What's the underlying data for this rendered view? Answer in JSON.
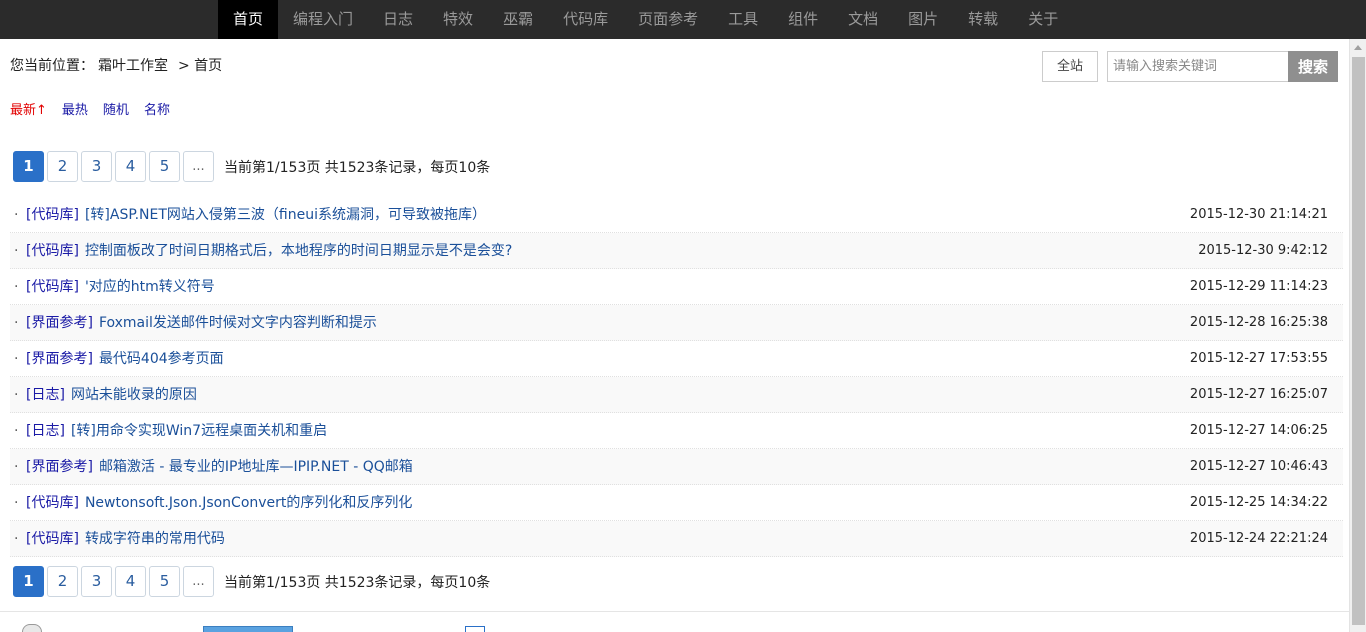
{
  "nav": {
    "items": [
      "首页",
      "编程入门",
      "日志",
      "特效",
      "巫霸",
      "代码库",
      "页面参考",
      "工具",
      "组件",
      "文档",
      "图片",
      "转载",
      "关于"
    ],
    "active_index": 0
  },
  "breadcrumb": {
    "prefix": "您当前位置：",
    "site": "霜叶工作室",
    "current": "> 首页"
  },
  "search": {
    "scope_label": "全站",
    "placeholder": "请输入搜索关键词",
    "button_label": "搜索"
  },
  "sorts": [
    {
      "label": "最新↑",
      "active": true
    },
    {
      "label": "最热",
      "active": false
    },
    {
      "label": "随机",
      "active": false
    },
    {
      "label": "名称",
      "active": false
    }
  ],
  "pager": {
    "pages": [
      "1",
      "2",
      "3",
      "4",
      "5",
      "..."
    ],
    "active_page": "1",
    "info": "当前第1/153页 共1523条记录，每页10条"
  },
  "articles": [
    {
      "category": "[代码库]",
      "title": "[转]ASP.NET网站入侵第三波（fineui系统漏洞，可导致被拖库）",
      "date": "2015-12-30 21:14:21"
    },
    {
      "category": "[代码库]",
      "title": "控制面板改了时间日期格式后，本地程序的时间日期显示是不是会变?",
      "date": "2015-12-30 9:42:12"
    },
    {
      "category": "[代码库]",
      "title": "'对应的htm转义符号",
      "date": "2015-12-29 11:14:23"
    },
    {
      "category": "[界面参考]",
      "title": "Foxmail发送邮件时候对文字内容判断和提示",
      "date": "2015-12-28 16:25:38"
    },
    {
      "category": "[界面参考]",
      "title": "最代码404参考页面",
      "date": "2015-12-27 17:53:55"
    },
    {
      "category": "[日志]",
      "title": "网站未能收录的原因",
      "date": "2015-12-27 16:25:07"
    },
    {
      "category": "[日志]",
      "title": "[转]用命令实现Win7远程桌面关机和重启",
      "date": "2015-12-27 14:06:25"
    },
    {
      "category": "[界面参考]",
      "title": "邮箱激活 - 最专业的IP地址库—IPIP.NET - QQ邮箱",
      "date": "2015-12-27 10:46:43"
    },
    {
      "category": "[代码库]",
      "title": "Newtonsoft.Json.JsonConvert的序列化和反序列化",
      "date": "2015-12-25 14:34:22"
    },
    {
      "category": "[代码库]",
      "title": "转成字符串的常用代码",
      "date": "2015-12-24 22:21:24"
    }
  ]
}
